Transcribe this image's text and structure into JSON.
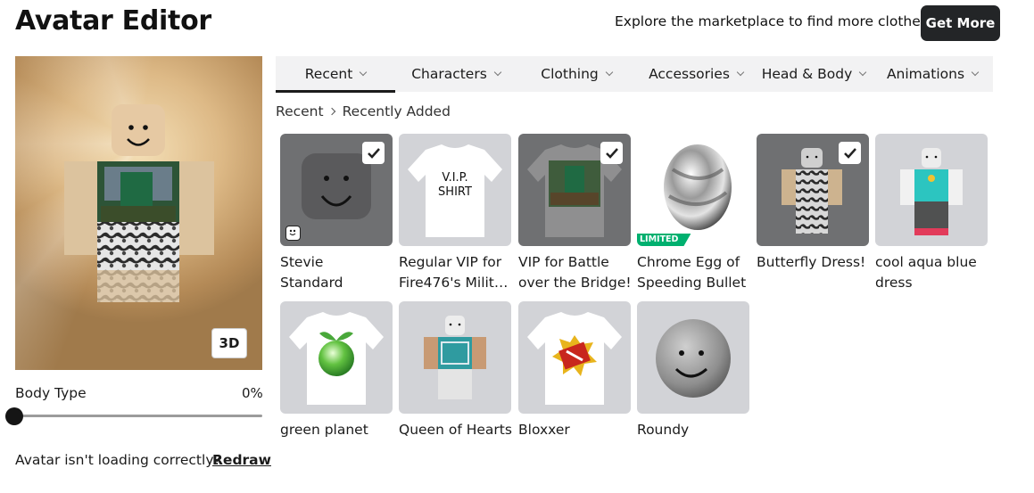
{
  "header": {
    "title": "Avatar Editor",
    "promo_text": "Explore the marketplace to find more clothes!",
    "get_more_label": "Get More"
  },
  "preview": {
    "mode_button": "3D"
  },
  "body_type": {
    "label": "Body Type",
    "value": "0%",
    "slider_level": 0
  },
  "footer": {
    "loading_text": "Avatar isn't loading correctly?",
    "redraw_label": "Redraw"
  },
  "tabs": [
    {
      "label": "Recent",
      "active": true
    },
    {
      "label": "Characters",
      "active": false
    },
    {
      "label": "Clothing",
      "active": false
    },
    {
      "label": "Accessories",
      "active": false
    },
    {
      "label": "Head & Body",
      "active": false
    },
    {
      "label": "Animations",
      "active": false
    }
  ],
  "breadcrumb": {
    "root": "Recent",
    "current": "Recently Added"
  },
  "items": [
    {
      "line1": "Stevie",
      "line2": "Standard",
      "thumb": "gray-face-head-icon",
      "selected": true,
      "badge": "face"
    },
    {
      "line1": "Regular VIP for",
      "line2": "Fire476's Militar...",
      "thumb": "vip-shirt-icon",
      "shirt_text_1": "V.I.P.",
      "shirt_text_2": "SHIRT",
      "selected": false
    },
    {
      "line1": "VIP for Battle",
      "line2": "over the Bridge!",
      "thumb": "battle-shirt-icon",
      "selected": true
    },
    {
      "line1": "Chrome Egg of",
      "line2": "Speeding Bullet",
      "thumb": "chrome-egg-icon",
      "selected": false,
      "limited_label": "LIMITED"
    },
    {
      "line1": "Butterfly Dress!",
      "line2": "",
      "thumb": "butterfly-dress-icon",
      "selected": true
    },
    {
      "line1": "cool aqua blue",
      "line2": "dress",
      "thumb": "aqua-dress-icon",
      "selected": false
    },
    {
      "line1": "green planet",
      "line2": "",
      "thumb": "green-planet-shirt-icon",
      "selected": false
    },
    {
      "line1": "Queen of Hearts",
      "line2": "",
      "thumb": "queen-of-hearts-icon",
      "selected": false
    },
    {
      "line1": "Bloxxer",
      "line2": "",
      "thumb": "bloxxer-shirt-icon",
      "selected": false
    },
    {
      "line1": "Roundy",
      "line2": "",
      "thumb": "roundy-head-icon",
      "selected": false
    }
  ],
  "colors": {
    "accent_dark": "#232527",
    "limited_green": "#00b06f",
    "thumb_bg": "#d2d3d7"
  }
}
